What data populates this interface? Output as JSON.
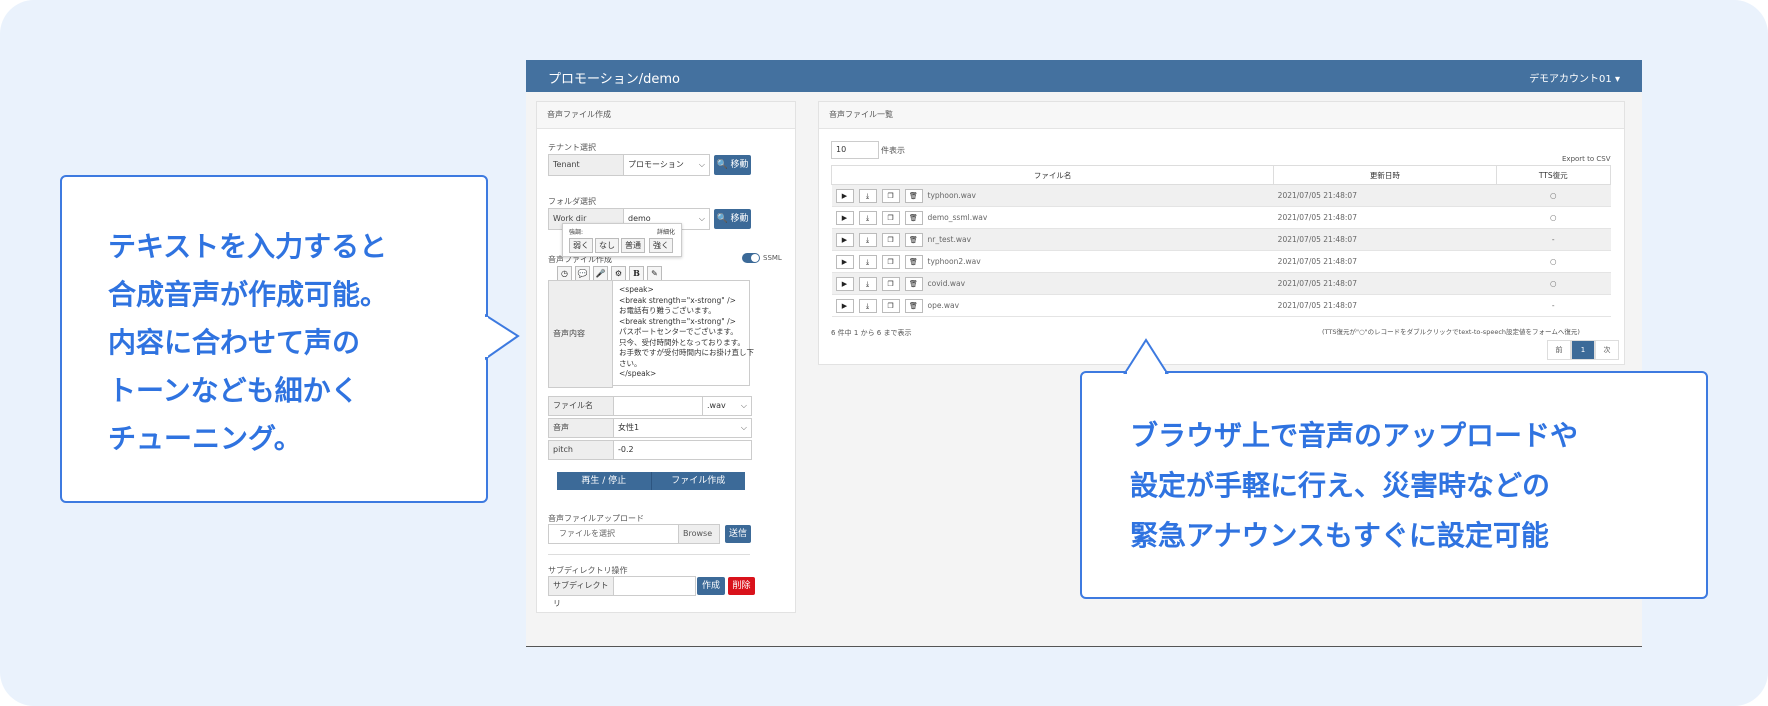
{
  "app": {
    "title": "プロモーション/demo",
    "account": "デモアカウント01 ▾"
  },
  "left_panel": {
    "header": "音声ファイル作成",
    "tenant_caption": "テナント選択",
    "tenant_label": "Tenant",
    "tenant_value": "プロモーション",
    "move_label": "🔍 移動",
    "folder_caption": "フォルダ選択",
    "workdir_label": "Work dir",
    "workdir_value": "demo",
    "audio_file_caption": "音声ファイル作成",
    "ssml_label": "SSML",
    "tooltip": {
      "left_caption": "強調:",
      "right_caption": "詳細化",
      "buttons": [
        "弱く",
        "なし",
        "普通",
        "強く"
      ]
    },
    "toolbar_icons": [
      "clock-icon",
      "speech-bubble-icon",
      "microphone-icon",
      "gear-icon",
      "bold-icon",
      "pencil-icon"
    ],
    "content_label": "音声内容",
    "content_lines": [
      "<speak>",
      "<break strength=\"x-strong\" />",
      "お電話有り難うございます。",
      "<break strength=\"x-strong\" />",
      "パスポートセンターでございます。",
      "只今、受付時間外となっております。",
      "お手数ですが受付時間内にお掛け直し下",
      "さい。",
      "</speak>"
    ],
    "filename_label": "ファイル名",
    "filename_ext": ".wav",
    "voice_label": "音声",
    "voice_value": "女性1",
    "pitch_label": "pitch",
    "pitch_value": "-0.2",
    "play_stop_label": "再生 / 停止",
    "create_file_label": "ファイル作成",
    "upload_caption": "音声ファイルアップロード",
    "upload_placeholder": "ファイルを選択",
    "browse_label": "Browse",
    "send_label": "送信",
    "subdir_caption": "サブディレクトリ操作",
    "subdir_label": "サブディレクトリ",
    "create_label": "作成",
    "delete_label": "削除"
  },
  "right_panel": {
    "header": "音声ファイル一覧",
    "page_size": "10",
    "page_size_suffix": "件表示",
    "export_label": "Export to CSV",
    "columns": [
      "ファイル名",
      "更新日時",
      "TTS復元"
    ],
    "rows": [
      {
        "name": "typhoon.wav",
        "date": "2021/07/05 21:48:07",
        "tts": "○"
      },
      {
        "name": "demo_ssml.wav",
        "date": "2021/07/05 21:48:07",
        "tts": "○"
      },
      {
        "name": "nr_test.wav",
        "date": "2021/07/05 21:48:07",
        "tts": "-"
      },
      {
        "name": "typhoon2.wav",
        "date": "2021/07/05 21:48:07",
        "tts": "○"
      },
      {
        "name": "covid.wav",
        "date": "2021/07/05 21:48:07",
        "tts": "○"
      },
      {
        "name": "ope.wav",
        "date": "2021/07/05 21:48:07",
        "tts": "-"
      }
    ],
    "summary": "6 件中 1 から 6 まで表示",
    "note": "(TTS復元が\"○\"のレコードをダブルクリックでtext-to-speech設定値をフォームへ復元)",
    "pager": {
      "prev": "前",
      "current": "1",
      "next": "次"
    }
  },
  "callout_left": {
    "lines": [
      "テキストを入力すると",
      "合成音声が作成可能。",
      "内容に合わせて声の",
      "トーンなども細かく",
      "チューニング。"
    ]
  },
  "callout_right": {
    "lines": [
      "ブラウザ上で音声のアップロードや",
      "設定が手軽に行え、災害時などの",
      "緊急アナウンスもすぐに設定可能"
    ]
  },
  "colors": {
    "accent": "#2f73e0",
    "topbar": "#44719f",
    "button": "#3c6a98",
    "danger": "#d9121b",
    "background": "#eaf2fc"
  }
}
